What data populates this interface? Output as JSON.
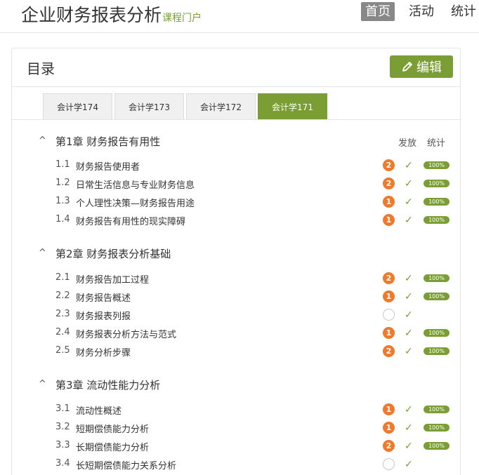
{
  "header": {
    "title": "企业财务报表分析",
    "subtitle": "课程门户",
    "nav": [
      "首页",
      "活动",
      "统计"
    ]
  },
  "panel": {
    "title": "目录",
    "edit_label": "编辑",
    "tabs": [
      "会计学174",
      "会计学173",
      "会计学172",
      "会计学171"
    ],
    "active_tab": "会计学171",
    "col_publish": "发放",
    "col_stats": "统计"
  },
  "chapters": [
    {
      "title": "第1章 财务报告有用性",
      "sections": [
        {
          "num": "1.1",
          "title": "财务报告使用者",
          "badge": "2",
          "pct": "100%"
        },
        {
          "num": "1.2",
          "title": "日常生活信息与专业财务信息",
          "badge": "2",
          "pct": "100%"
        },
        {
          "num": "1.3",
          "title": "个人理性决策—财务报告用途",
          "badge": "1",
          "pct": "100%"
        },
        {
          "num": "1.4",
          "title": "财务报告有用性的现实障碍",
          "badge": "1",
          "pct": "100%"
        }
      ]
    },
    {
      "title": "第2章 财务报表分析基础",
      "sections": [
        {
          "num": "2.1",
          "title": "财务报告加工过程",
          "badge": "2",
          "pct": "100%"
        },
        {
          "num": "2.2",
          "title": "财务报告概述",
          "badge": "1",
          "pct": "100%"
        },
        {
          "num": "2.3",
          "title": "财务报表列报",
          "badge": "",
          "pct": ""
        },
        {
          "num": "2.4",
          "title": "财务报表分析方法与范式",
          "badge": "1",
          "pct": "100%"
        },
        {
          "num": "2.5",
          "title": "财务分析步骤",
          "badge": "2",
          "pct": "100%"
        }
      ]
    },
    {
      "title": "第3章 流动性能力分析",
      "sections": [
        {
          "num": "3.1",
          "title": "流动性概述",
          "badge": "1",
          "pct": "100%"
        },
        {
          "num": "3.2",
          "title": "短期偿债能力分析",
          "badge": "1",
          "pct": "100%"
        },
        {
          "num": "3.3",
          "title": "长期偿债能力分析",
          "badge": "2",
          "pct": "100%"
        },
        {
          "num": "3.4",
          "title": "长短期偿债能力关系分析",
          "badge": "",
          "pct": ""
        }
      ]
    }
  ],
  "icons": {
    "collapse": "chevron-up-icon",
    "check": "check-icon",
    "edit": "pencil-icon"
  },
  "colors": {
    "accent": "#7a9e33",
    "badge": "#f07a2c"
  }
}
